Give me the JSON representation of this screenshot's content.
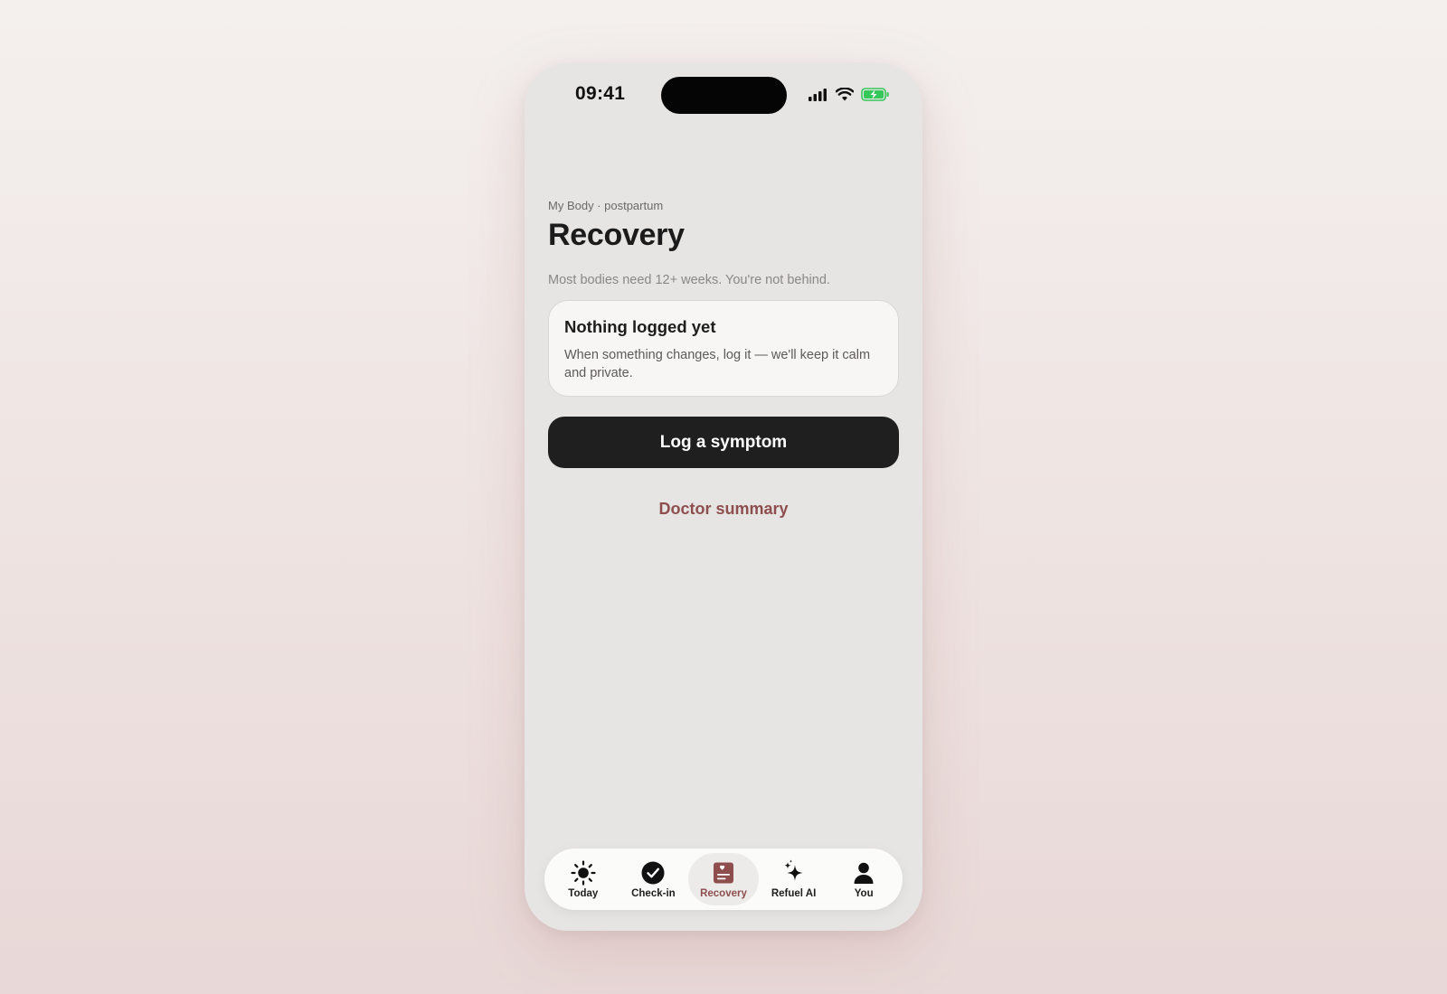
{
  "status_bar": {
    "time": "09:41"
  },
  "header": {
    "eyebrow": "My Body · postpartum",
    "title": "Recovery",
    "subtitle": "Most bodies need 12+ weeks. You're not behind."
  },
  "empty_state": {
    "title": "Nothing logged yet",
    "body": "When something changes, log it — we'll keep it calm and private."
  },
  "actions": {
    "primary_label": "Log a symptom",
    "secondary_label": "Doctor summary"
  },
  "tabbar": {
    "items": [
      {
        "label": "Today",
        "icon": "sun-icon",
        "active": false
      },
      {
        "label": "Check-in",
        "icon": "check-circle-icon",
        "active": false
      },
      {
        "label": "Recovery",
        "icon": "recovery-journal-icon",
        "active": true
      },
      {
        "label": "Refuel AI",
        "icon": "sparkle-icon",
        "active": false
      },
      {
        "label": "You",
        "icon": "person-icon",
        "active": false
      }
    ]
  },
  "colors": {
    "accent": "#8e4e4e",
    "primary_button": "#1f1f1f",
    "battery": "#34c759"
  }
}
